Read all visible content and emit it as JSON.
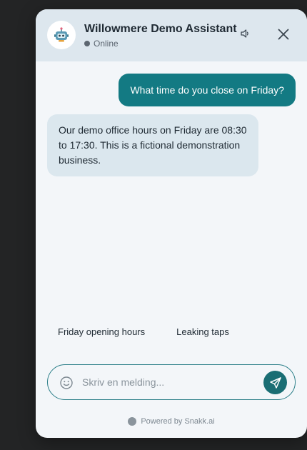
{
  "header": {
    "title": "Willowmere Demo Assistant",
    "status": "Online",
    "avatar_icon": "robot-icon",
    "sound_icon": "speaker-icon",
    "close_icon": "close-icon"
  },
  "messages": [
    {
      "role": "user",
      "text": "What time do you close on Friday?"
    },
    {
      "role": "assistant",
      "text": "Our demo office hours on Friday are 08:30 to 17:30. This is a fictional demonstration business."
    }
  ],
  "suggestions": [
    {
      "label": "Friday opening hours"
    },
    {
      "label": "Leaking taps"
    }
  ],
  "composer": {
    "placeholder": "Skriv en melding...",
    "value": "",
    "emoji_icon": "smiley-icon",
    "send_icon": "send-icon"
  },
  "footer": {
    "text": "Powered by Snakk.ai"
  },
  "colors": {
    "accent": "#137a83",
    "header_bg": "#dde7ee",
    "bot_bubble": "#dbe7ee",
    "page_bg": "#232425"
  }
}
